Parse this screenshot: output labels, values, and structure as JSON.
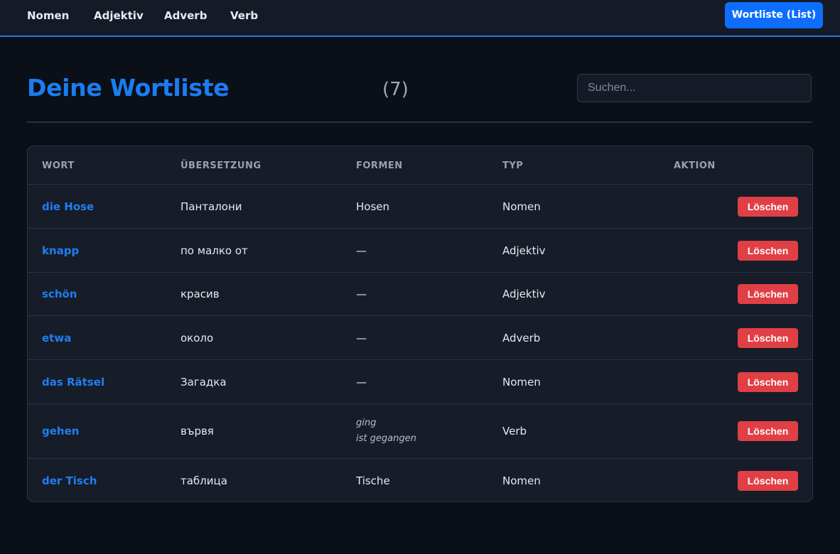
{
  "nav": {
    "items": [
      "Nomen",
      "Adjektiv",
      "Adverb",
      "Verb"
    ],
    "wordlist_button": "Wortliste (List)"
  },
  "header": {
    "title": "Deine Wortliste",
    "count": "(7)",
    "search_placeholder": "Suchen..."
  },
  "table": {
    "columns": [
      "WORT",
      "ÜBERSETZUNG",
      "FORMEN",
      "TYP",
      "AKTION"
    ],
    "delete_label": "Löschen",
    "rows": [
      {
        "word": "die Hose",
        "translation": "Панталони",
        "forms": [
          "Hosen"
        ],
        "forms_italic": false,
        "type": "Nomen"
      },
      {
        "word": "knapp",
        "translation": "по малко от",
        "forms": [
          "—"
        ],
        "forms_italic": false,
        "type": "Adjektiv"
      },
      {
        "word": "schön",
        "translation": "красив",
        "forms": [
          "—"
        ],
        "forms_italic": false,
        "type": "Adjektiv"
      },
      {
        "word": "etwa",
        "translation": "около",
        "forms": [
          "—"
        ],
        "forms_italic": false,
        "type": "Adverb"
      },
      {
        "word": "das Rätsel",
        "translation": "Загадка",
        "forms": [
          "—"
        ],
        "forms_italic": false,
        "type": "Nomen"
      },
      {
        "word": "gehen",
        "translation": "вървя",
        "forms": [
          "ging",
          "ist gegangen"
        ],
        "forms_italic": true,
        "type": "Verb"
      },
      {
        "word": "der Tisch",
        "translation": "таблица",
        "forms": [
          "Tische"
        ],
        "forms_italic": false,
        "type": "Nomen"
      }
    ]
  },
  "colors": {
    "accent": "#1a7df2",
    "delete": "#e03f45",
    "background": "#0b0f17",
    "card": "#161c28"
  }
}
